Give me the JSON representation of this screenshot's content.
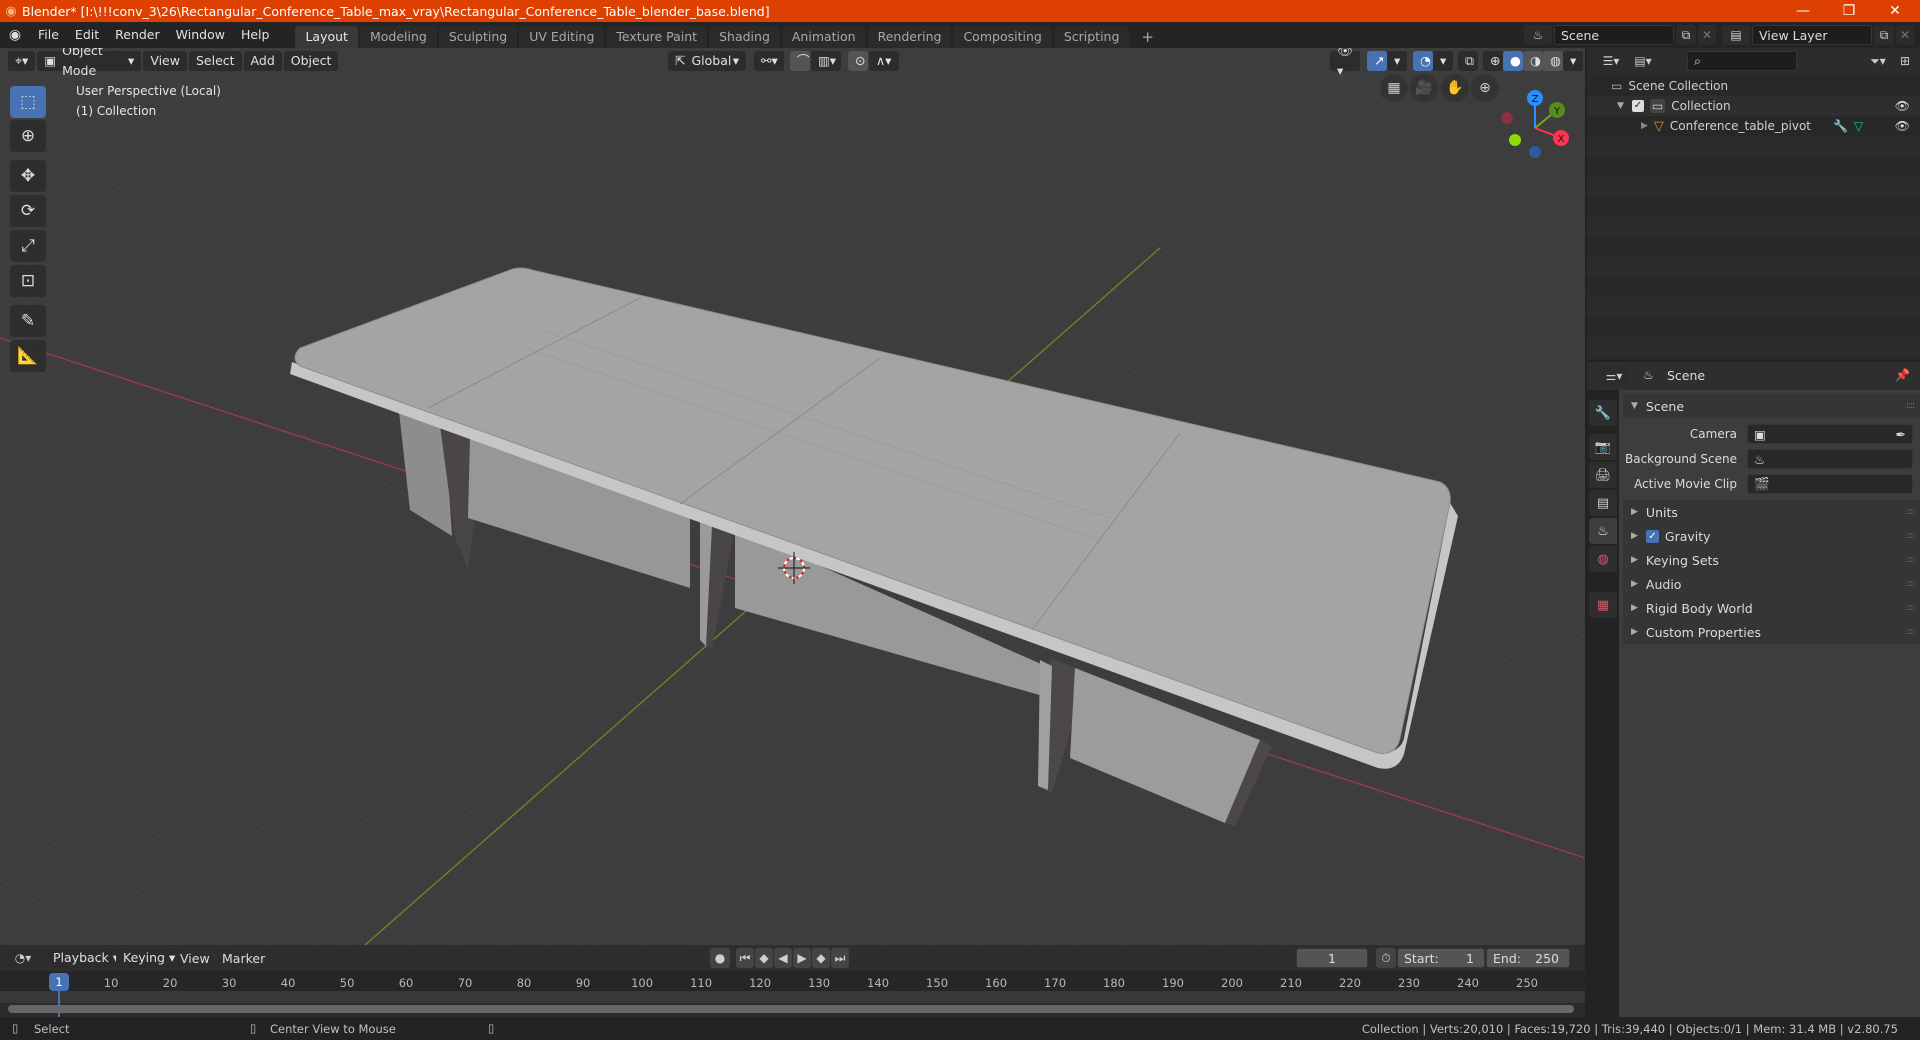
{
  "window": {
    "title": "Blender* [I:\\!!!conv_3\\26\\Rectangular_Conference_Table_max_vray\\Rectangular_Conference_Table_blender_base.blend]",
    "controls": {
      "minimize": "—",
      "maximize": "❐",
      "close": "✕"
    }
  },
  "menu": [
    "File",
    "Edit",
    "Render",
    "Window",
    "Help"
  ],
  "workspaces": [
    "Layout",
    "Modeling",
    "Sculpting",
    "UV Editing",
    "Texture Paint",
    "Shading",
    "Animation",
    "Rendering",
    "Compositing",
    "Scripting"
  ],
  "active_workspace": "Layout",
  "add_workspace": "+",
  "scene_selector": {
    "value": "Scene"
  },
  "view_layer_selector": {
    "value": "View Layer"
  },
  "viewport": {
    "mode": "Object Mode",
    "menus": [
      "View",
      "Select",
      "Add",
      "Object"
    ],
    "orientation": "Global",
    "info_line1": "User Perspective (Local)",
    "info_line2": "(1) Collection",
    "gizmo": {
      "x": "X",
      "y": "Y",
      "z": "Z"
    },
    "colors": {
      "x_axis": "#ff3352",
      "y_axis": "#8bdc00",
      "z_axis": "#2890ff",
      "selection": "#4772b3"
    }
  },
  "outliner": {
    "root": "Scene Collection",
    "items": [
      {
        "name": "Collection",
        "type": "collection",
        "checked": true
      },
      {
        "name": "Conference_table_pivot",
        "type": "object"
      }
    ]
  },
  "properties": {
    "header_context": "Scene",
    "panel_title": "Scene",
    "fields": [
      {
        "label": "Camera",
        "value": ""
      },
      {
        "label": "Background Scene",
        "value": ""
      },
      {
        "label": "Active Movie Clip",
        "value": ""
      }
    ],
    "subpanels": [
      {
        "label": "Units"
      },
      {
        "label": "Gravity",
        "checkbox": true
      },
      {
        "label": "Keying Sets"
      },
      {
        "label": "Audio"
      },
      {
        "label": "Rigid Body World"
      },
      {
        "label": "Custom Properties"
      }
    ]
  },
  "timeline": {
    "menus": [
      "Playback",
      "Keying",
      "View",
      "Marker"
    ],
    "current_frame": "1",
    "start_label": "Start:",
    "start": "1",
    "end_label": "End:",
    "end": "250",
    "ticks": [
      "10",
      "20",
      "30",
      "40",
      "50",
      "60",
      "70",
      "80",
      "90",
      "100",
      "110",
      "120",
      "130",
      "140",
      "150",
      "160",
      "170",
      "180",
      "190",
      "200",
      "210",
      "220",
      "230",
      "240",
      "250"
    ],
    "playhead": "1"
  },
  "statusbar": {
    "left_action": "Select",
    "middle_action": "Center View to Mouse",
    "stats": "Collection | Verts:20,010 | Faces:19,720 | Tris:39,440 | Objects:0/1 | Mem: 31.4 MB | v2.80.75"
  }
}
